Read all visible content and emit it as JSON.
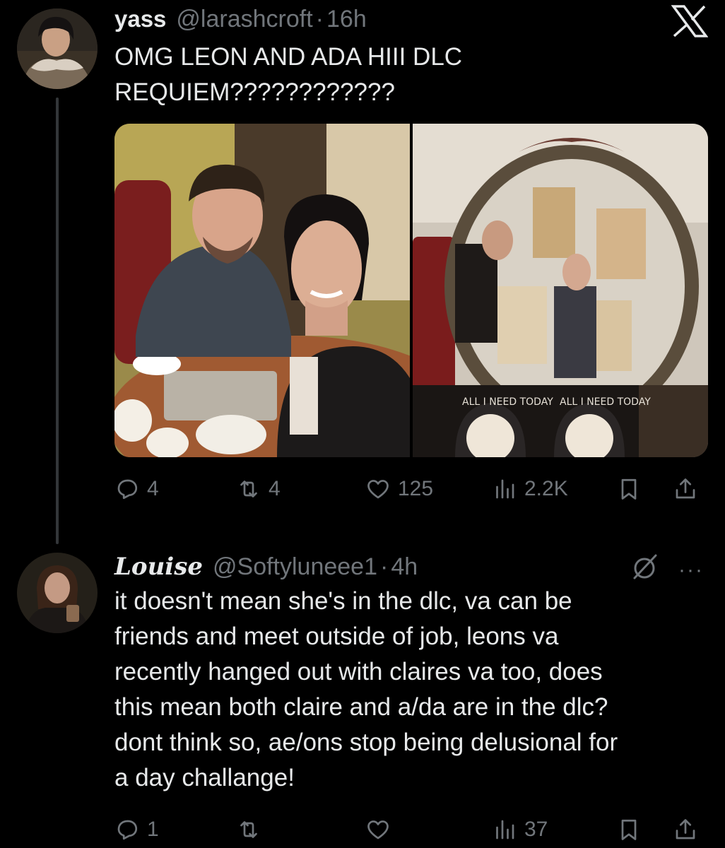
{
  "tweet": {
    "display_name": "yass",
    "handle": "@larashcroft",
    "separator": "·",
    "time": "16h",
    "text": "OMG LEON AND ADA HIII DLC\nREQUIEM????????????",
    "stats": {
      "replies": "4",
      "retweets": "4",
      "likes": "125",
      "views": "2.2K"
    }
  },
  "reply": {
    "display_name": "Louise",
    "handle": "@Softyluneee1",
    "separator": "·",
    "time": "4h",
    "more": "···",
    "text": "it doesn't mean she's in the dlc, va can be\nfriends and meet outside of job, leons va\nrecently hanged out with claires va too, does\nthis mean both claire and a/da are in the dlc?\ndont think so, ae/ons stop being delusional for\na day challange!",
    "stats": {
      "replies": "1",
      "retweets": "",
      "likes": "",
      "views": "37"
    }
  },
  "icons": {
    "reply": "reply-icon",
    "retweet": "retweet-icon",
    "like": "heart-icon",
    "views": "views-icon",
    "bookmark": "bookmark-icon",
    "share": "share-icon",
    "logo": "x-logo-icon"
  },
  "photo_text": {
    "sign": "ALL I NEED TODAY"
  },
  "colors": {
    "background": "#000000",
    "text": "#e7e9ea",
    "muted": "#71767b",
    "thread_line": "#333639"
  }
}
